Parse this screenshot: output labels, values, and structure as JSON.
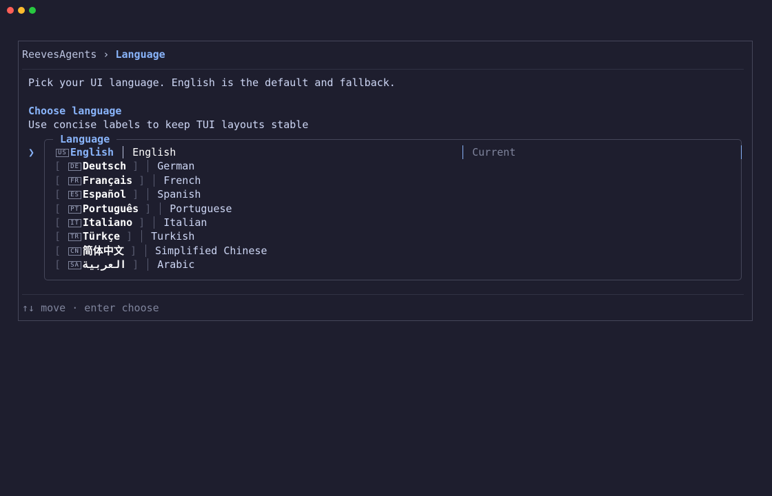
{
  "window": {
    "traffic_lights": [
      "close",
      "minimize",
      "zoom"
    ],
    "colors": {
      "close": "#ff5f57",
      "minimize": "#febc2e",
      "zoom": "#28c840"
    }
  },
  "breadcrumb": {
    "root": "ReevesAgents",
    "separator": "›",
    "current": "Language"
  },
  "intro": "Pick your UI language. English is the default and fallback.",
  "section": {
    "title": "Choose language",
    "subtitle": "Use concise labels to keep TUI layouts stable"
  },
  "list": {
    "title": "Language",
    "cursor": "❯",
    "current_label": "Current",
    "items": [
      {
        "flag": "US",
        "native": "English",
        "english": "English",
        "selected": true
      },
      {
        "flag": "DE",
        "native": "Deutsch",
        "english": "German"
      },
      {
        "flag": "FR",
        "native": "Français",
        "english": "French"
      },
      {
        "flag": "ES",
        "native": "Español",
        "english": "Spanish"
      },
      {
        "flag": "PT",
        "native": "Português",
        "english": "Portuguese"
      },
      {
        "flag": "IT",
        "native": "Italiano",
        "english": "Italian"
      },
      {
        "flag": "TR",
        "native": "Türkçe",
        "english": "Turkish"
      },
      {
        "flag": "CN",
        "native": "简体中文",
        "english": "Simplified Chinese"
      },
      {
        "flag": "SA",
        "native": "العربية",
        "english": "Arabic"
      }
    ]
  },
  "footer": {
    "hint": "↑↓ move · enter choose"
  },
  "colors": {
    "background": "#1e1e2e",
    "accent": "#89b4fa",
    "border": "#45475a",
    "muted": "#7f849c"
  }
}
